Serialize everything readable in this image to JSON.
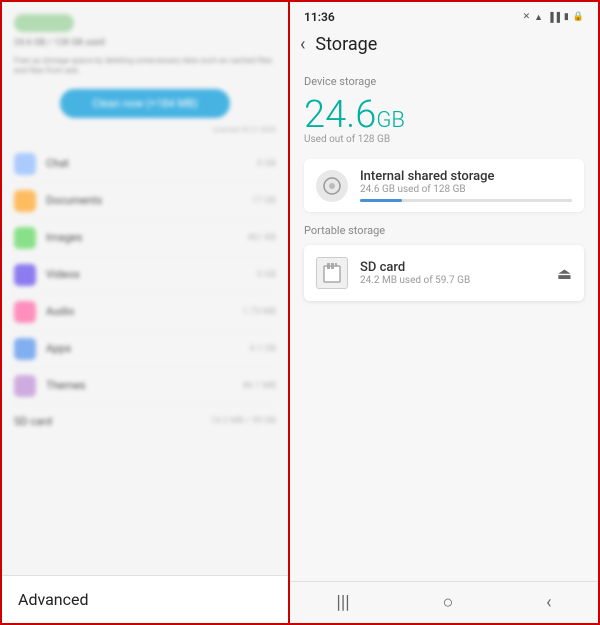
{
  "left": {
    "storage_pill_label": "",
    "storage_used_text": "24.6 GB / 128 GB used",
    "free_up_text": "Free up storage space by deleting unnecessary data such as cached files and files from ads.",
    "clean_btn": "Clean now (+184 MB)",
    "timestamp": "scanned 30 21 2020",
    "files": [
      {
        "label": "Chat",
        "size": "0 GB",
        "type": "chat"
      },
      {
        "label": "Documents",
        "size": "17 GB",
        "type": "documents"
      },
      {
        "label": "Images",
        "size": "461 KB",
        "type": "images"
      },
      {
        "label": "Videos",
        "size": "0 GB",
        "type": "videos"
      },
      {
        "label": "Audio",
        "size": "1.73 MB",
        "type": "audio"
      },
      {
        "label": "Apps",
        "size": "4.1 GB",
        "type": "apps"
      },
      {
        "label": "Themes",
        "size": "86.1 MB",
        "type": "themes"
      }
    ],
    "sd_card_label": "SD card",
    "sd_card_size": "14.2 MB / 59 GB",
    "advanced_label": "Advanced"
  },
  "right": {
    "status_bar": {
      "time": "11:36",
      "icons": [
        "✕",
        "📶",
        "🔋",
        "🔒"
      ]
    },
    "back_label": "‹",
    "title": "Storage",
    "device_storage_label": "Device storage",
    "device_storage_size": "24.6",
    "device_storage_unit": "GB",
    "used_out_of": "Used out of 128 GB",
    "internal_storage": {
      "name": "Internal shared storage",
      "sub": "24.6 GB used of 128 GB",
      "bar_pct": 20
    },
    "portable_label": "Portable storage",
    "sd_card": {
      "name": "SD card",
      "sub": "24.2 MB used of 59.7 GB"
    },
    "nav_icons": [
      "|||",
      "○",
      "‹"
    ]
  }
}
